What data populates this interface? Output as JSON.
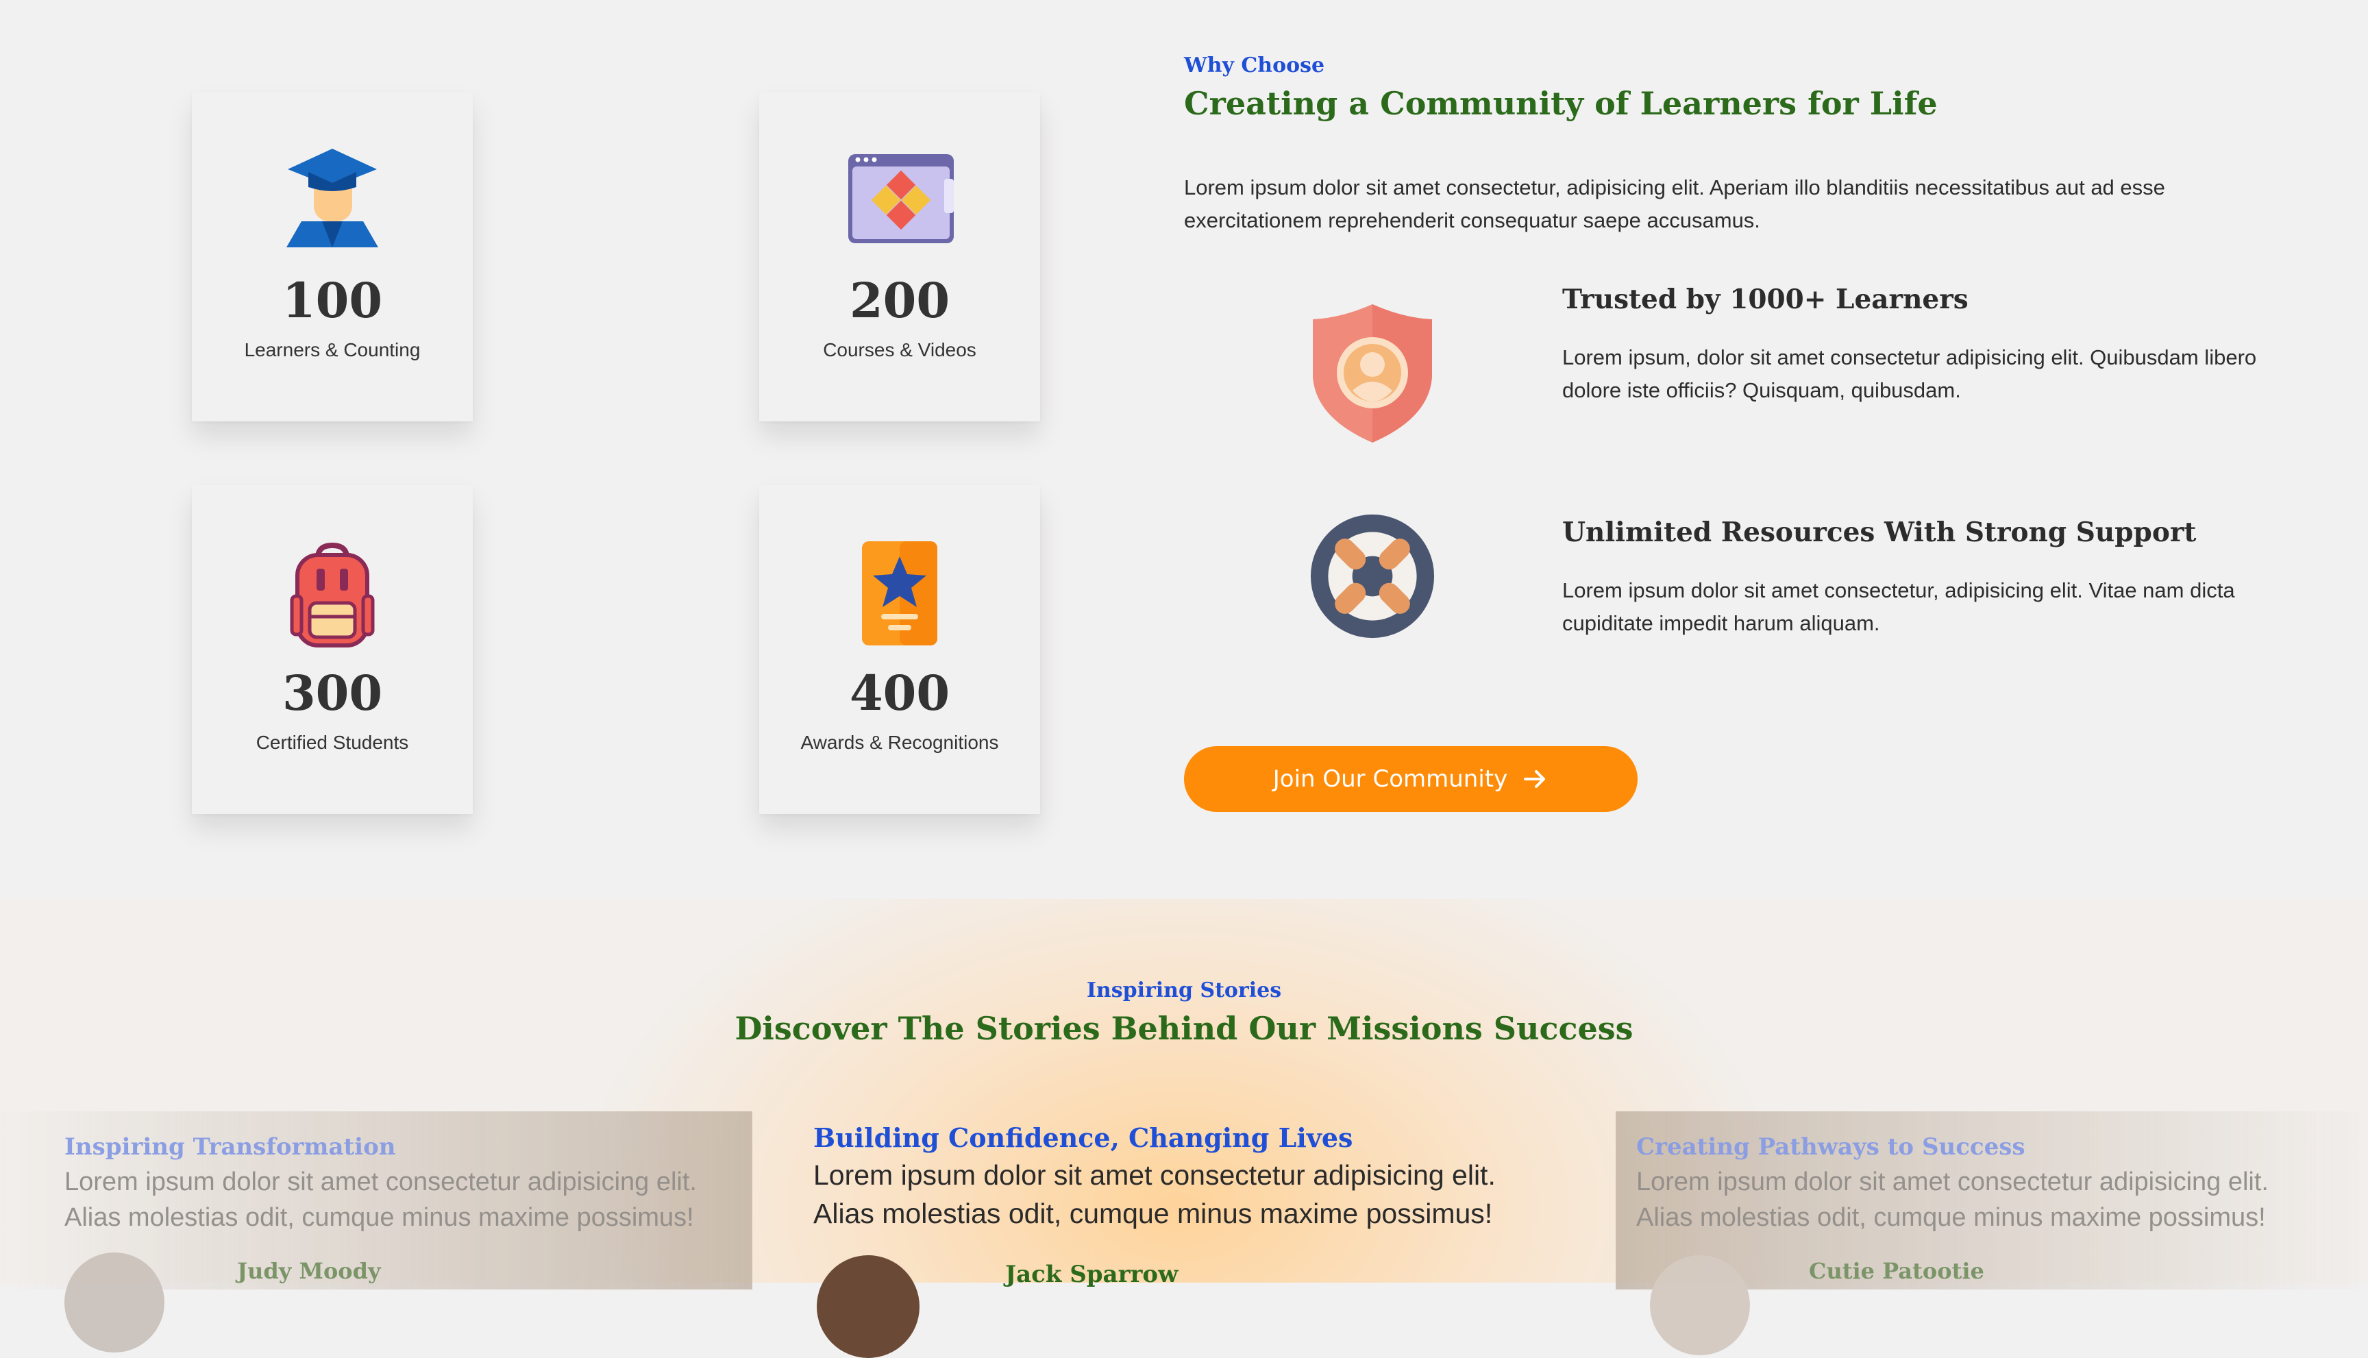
{
  "stats": [
    {
      "number": "100",
      "label": "Learners & Counting",
      "icon": "graduate-icon"
    },
    {
      "number": "200",
      "label": "Courses & Videos",
      "icon": "calculator-window-icon"
    },
    {
      "number": "300",
      "label": "Certified Students",
      "icon": "backpack-icon"
    },
    {
      "number": "400",
      "label": "Awards & Recognitions",
      "icon": "award-badge-icon"
    }
  ],
  "why": {
    "eyebrow": "Why Choose",
    "heading": "Creating a Community of Learners for Life",
    "intro": "Lorem ipsum dolor sit amet consectetur, adipisicing elit. Aperiam illo blanditiis necessitatibus aut ad esse exercitationem reprehenderit consequatur saepe accusamus.",
    "features": [
      {
        "title": "Trusted by 1000+ Learners",
        "text": "Lorem ipsum, dolor sit amet consectetur adipisicing elit. Quibusdam libero dolore iste officiis? Quisquam, quibusdam.",
        "icon": "shield-user-icon"
      },
      {
        "title": "Unlimited Resources With Strong Support",
        "text": "Lorem ipsum dolor sit amet consectetur, adipisicing elit. Vitae nam dicta cupiditate impedit harum aliquam.",
        "icon": "lifebuoy-icon"
      }
    ],
    "cta": "Join Our Community"
  },
  "stories": {
    "eyebrow": "Inspiring Stories",
    "heading": "Discover The Stories Behind Our Missions Success",
    "cards": [
      {
        "title": "Inspiring Transformation",
        "text1": "Lorem ipsum dolor sit amet consectetur adipisicing elit.",
        "text2": "Alias molestias odit, cumque minus maxime possimus!",
        "name": "Judy Moody"
      },
      {
        "title": "Building Confidence, Changing Lives",
        "text1": "Lorem ipsum dolor sit amet consectetur adipisicing elit.",
        "text2": "Alias molestias odit, cumque minus maxime possimus!",
        "name": "Jack Sparrow"
      },
      {
        "title": "Creating Pathways to Success",
        "text1": "Lorem ipsum dolor sit amet consectetur adipisicing elit.",
        "text2": "Alias molestias odit, cumque minus maxime possimus!",
        "name": "Cutie Patootie"
      }
    ]
  },
  "colors": {
    "accent": "#fe8c08",
    "eyebrow": "#1e4fd6",
    "heading": "#2b6a1a"
  }
}
